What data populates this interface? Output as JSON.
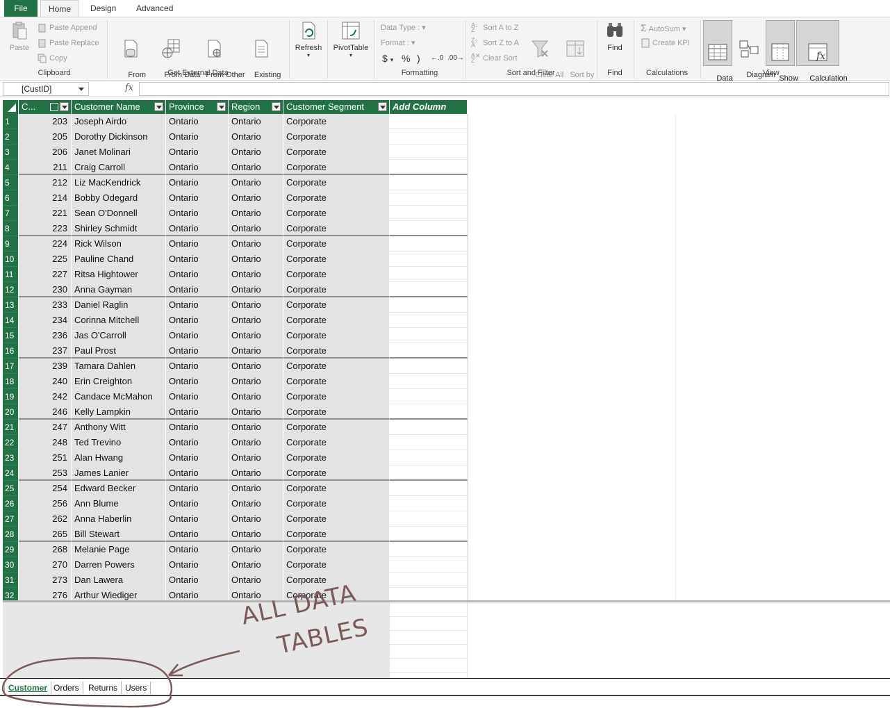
{
  "ribbon": {
    "tabs": [
      {
        "label": "File"
      },
      {
        "label": "Home"
      },
      {
        "label": "Design"
      },
      {
        "label": "Advanced"
      }
    ],
    "clipboard": {
      "paste": "Paste",
      "paste_append": "Paste Append",
      "paste_replace": "Paste Replace",
      "copy": "Copy",
      "group_label": "Clipboard"
    },
    "external": {
      "from_database": "From\nDatabase",
      "from_data_service": "From Data\nService",
      "from_other_sources": "From Other\nSources",
      "existing_connections": "Existing\nConnections",
      "group_label": "Get External Data"
    },
    "refresh": "Refresh",
    "pivottable": "PivotTable",
    "formatting": {
      "data_type": "Data Type :",
      "format": "Format :",
      "currency": "$",
      "percent": "%",
      "comma": ")",
      "group_label": "Formatting"
    },
    "sort": {
      "sort_a_to_z": "Sort A to Z",
      "sort_z_to_a": "Sort Z to A",
      "clear_sort": "Clear Sort",
      "clear_all_filters": "Clear All\nFilters",
      "sort_by_column": "Sort by\nColumn",
      "group_label": "Sort and Filter"
    },
    "find": {
      "label": "Find",
      "group_label": "Find"
    },
    "calculations": {
      "autosum": "AutoSum",
      "create_kpi": "Create KPI",
      "group_label": "Calculations"
    },
    "view": {
      "data_view": "Data\nView",
      "diagram_view": "Diagram\nView",
      "show_hidden": "Show\nHidden",
      "calculation_area": "Calculation\nArea",
      "group_label": "View"
    }
  },
  "formula_bar": {
    "name_box": "[CustID]",
    "fx": "fx",
    "formula": ""
  },
  "table": {
    "columns": [
      "C...",
      "Customer Name",
      "Province",
      "Region",
      "Customer Segment",
      "Add Column"
    ],
    "rows": [
      {
        "n": "1",
        "id": "203",
        "name": "Joseph Airdo",
        "province": "Ontario",
        "region": "Ontario",
        "segment": "Corporate"
      },
      {
        "n": "2",
        "id": "205",
        "name": "Dorothy Dickinson",
        "province": "Ontario",
        "region": "Ontario",
        "segment": "Corporate"
      },
      {
        "n": "3",
        "id": "206",
        "name": "Janet Molinari",
        "province": "Ontario",
        "region": "Ontario",
        "segment": "Corporate"
      },
      {
        "n": "4",
        "id": "211",
        "name": "Craig Carroll",
        "province": "Ontario",
        "region": "Ontario",
        "segment": "Corporate"
      },
      {
        "n": "5",
        "id": "212",
        "name": "Liz MacKendrick",
        "province": "Ontario",
        "region": "Ontario",
        "segment": "Corporate"
      },
      {
        "n": "6",
        "id": "214",
        "name": "Bobby Odegard",
        "province": "Ontario",
        "region": "Ontario",
        "segment": "Corporate"
      },
      {
        "n": "7",
        "id": "221",
        "name": "Sean O'Donnell",
        "province": "Ontario",
        "region": "Ontario",
        "segment": "Corporate"
      },
      {
        "n": "8",
        "id": "223",
        "name": "Shirley Schmidt",
        "province": "Ontario",
        "region": "Ontario",
        "segment": "Corporate"
      },
      {
        "n": "9",
        "id": "224",
        "name": "Rick Wilson",
        "province": "Ontario",
        "region": "Ontario",
        "segment": "Corporate"
      },
      {
        "n": "10",
        "id": "225",
        "name": "Pauline Chand",
        "province": "Ontario",
        "region": "Ontario",
        "segment": "Corporate"
      },
      {
        "n": "11",
        "id": "227",
        "name": "Ritsa Hightower",
        "province": "Ontario",
        "region": "Ontario",
        "segment": "Corporate"
      },
      {
        "n": "12",
        "id": "230",
        "name": "Anna Gayman",
        "province": "Ontario",
        "region": "Ontario",
        "segment": "Corporate"
      },
      {
        "n": "13",
        "id": "233",
        "name": "Daniel Raglin",
        "province": "Ontario",
        "region": "Ontario",
        "segment": "Corporate"
      },
      {
        "n": "14",
        "id": "234",
        "name": "Corinna Mitchell",
        "province": "Ontario",
        "region": "Ontario",
        "segment": "Corporate"
      },
      {
        "n": "15",
        "id": "236",
        "name": "Jas O'Carroll",
        "province": "Ontario",
        "region": "Ontario",
        "segment": "Corporate"
      },
      {
        "n": "16",
        "id": "237",
        "name": "Paul Prost",
        "province": "Ontario",
        "region": "Ontario",
        "segment": "Corporate"
      },
      {
        "n": "17",
        "id": "239",
        "name": "Tamara Dahlen",
        "province": "Ontario",
        "region": "Ontario",
        "segment": "Corporate"
      },
      {
        "n": "18",
        "id": "240",
        "name": "Erin Creighton",
        "province": "Ontario",
        "region": "Ontario",
        "segment": "Corporate"
      },
      {
        "n": "19",
        "id": "242",
        "name": "Candace McMahon",
        "province": "Ontario",
        "region": "Ontario",
        "segment": "Corporate"
      },
      {
        "n": "20",
        "id": "246",
        "name": "Kelly Lampkin",
        "province": "Ontario",
        "region": "Ontario",
        "segment": "Corporate"
      },
      {
        "n": "21",
        "id": "247",
        "name": "Anthony Witt",
        "province": "Ontario",
        "region": "Ontario",
        "segment": "Corporate"
      },
      {
        "n": "22",
        "id": "248",
        "name": "Ted Trevino",
        "province": "Ontario",
        "region": "Ontario",
        "segment": "Corporate"
      },
      {
        "n": "23",
        "id": "251",
        "name": "Alan Hwang",
        "province": "Ontario",
        "region": "Ontario",
        "segment": "Corporate"
      },
      {
        "n": "24",
        "id": "253",
        "name": "James Lanier",
        "province": "Ontario",
        "region": "Ontario",
        "segment": "Corporate"
      },
      {
        "n": "25",
        "id": "254",
        "name": "Edward Becker",
        "province": "Ontario",
        "region": "Ontario",
        "segment": "Corporate"
      },
      {
        "n": "26",
        "id": "256",
        "name": "Ann Blume",
        "province": "Ontario",
        "region": "Ontario",
        "segment": "Corporate"
      },
      {
        "n": "27",
        "id": "262",
        "name": "Anna Haberlin",
        "province": "Ontario",
        "region": "Ontario",
        "segment": "Corporate"
      },
      {
        "n": "28",
        "id": "265",
        "name": "Bill Stewart",
        "province": "Ontario",
        "region": "Ontario",
        "segment": "Corporate"
      },
      {
        "n": "29",
        "id": "268",
        "name": "Melanie Page",
        "province": "Ontario",
        "region": "Ontario",
        "segment": "Corporate"
      },
      {
        "n": "30",
        "id": "270",
        "name": "Darren Powers",
        "province": "Ontario",
        "region": "Ontario",
        "segment": "Corporate"
      },
      {
        "n": "31",
        "id": "273",
        "name": "Dan Lawera",
        "province": "Ontario",
        "region": "Ontario",
        "segment": "Corporate"
      },
      {
        "n": "32",
        "id": "276",
        "name": "Arthur Wiediger",
        "province": "Ontario",
        "region": "Ontario",
        "segment": "Corporate"
      }
    ]
  },
  "sheet_tabs": [
    {
      "label": "Customer",
      "active": true
    },
    {
      "label": "Orders"
    },
    {
      "label": "Returns"
    },
    {
      "label": "Users"
    }
  ],
  "annotation": {
    "line1": "ALL DATA",
    "line2": "TABLES",
    "color": "#7b5a57"
  },
  "colors": {
    "accent": "#217346",
    "cell_bg": "#e3e3e3"
  }
}
